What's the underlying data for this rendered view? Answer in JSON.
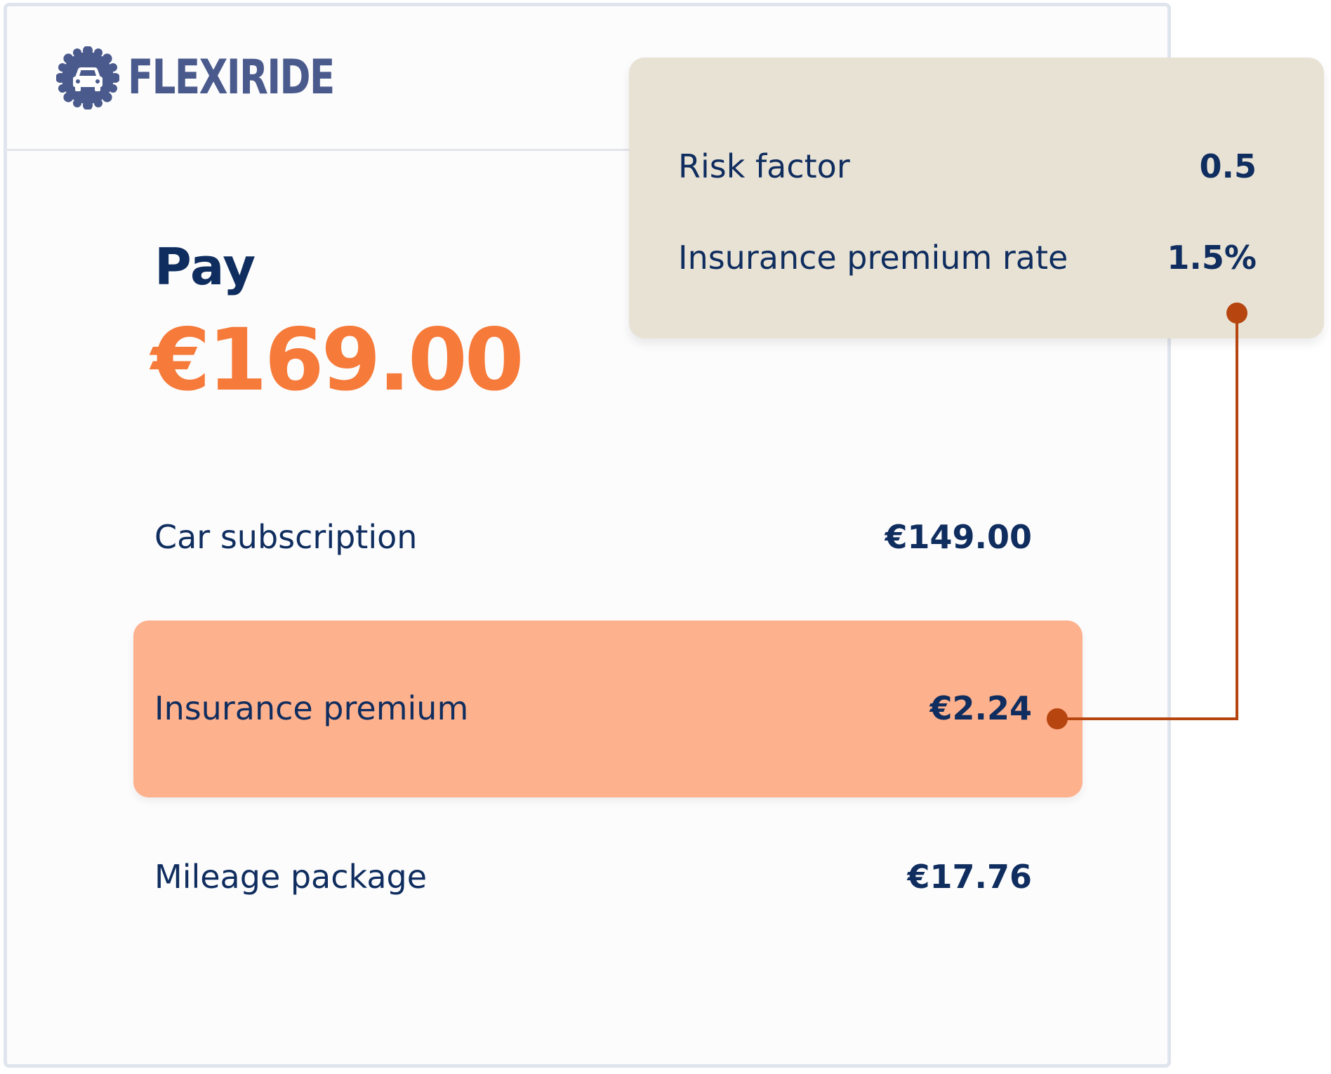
{
  "brand": {
    "name": "FLEXIRIDE",
    "logo_icon": "car-badge-icon",
    "color": "#4a5a8c"
  },
  "payment": {
    "label": "Pay",
    "total": "€169.00",
    "total_color": "#f67a39"
  },
  "line_items": [
    {
      "label": "Car subscription",
      "value": "€149.00"
    },
    {
      "label": "Insurance premium",
      "value": "€2.24",
      "highlight_color": "#feb18d"
    },
    {
      "label": "Mileage package",
      "value": "€17.76"
    }
  ],
  "details_popover": {
    "background": "#e8e2d5",
    "rows": [
      {
        "label": "Risk factor",
        "value": "0.5"
      },
      {
        "label": "Insurance premium rate",
        "value": "1.5%"
      }
    ]
  },
  "connector_color": "#b6450f",
  "text_color": "#0f2d5e"
}
